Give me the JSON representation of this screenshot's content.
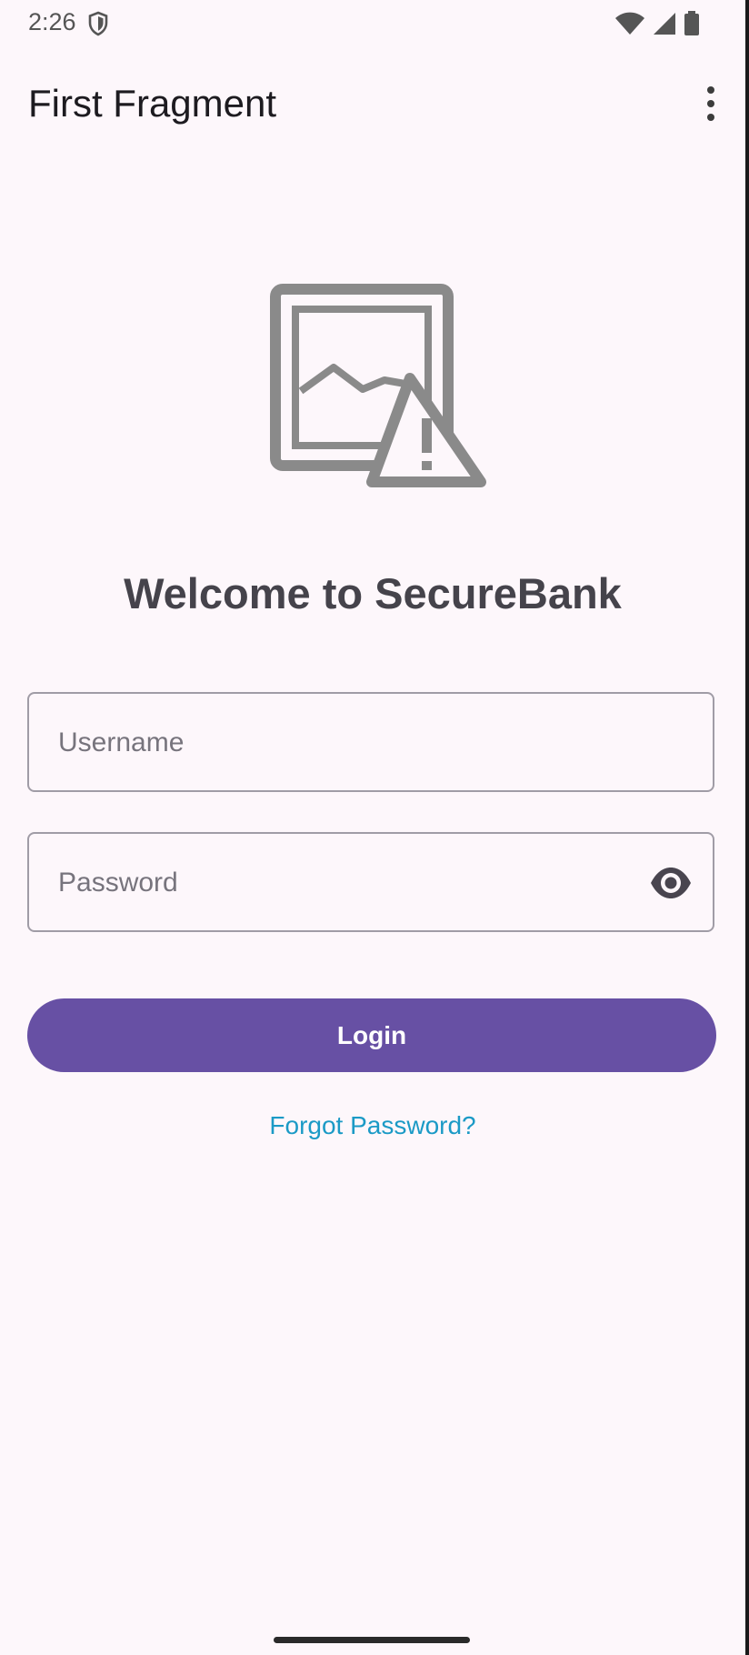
{
  "status_bar": {
    "time": "2:26",
    "icons": [
      "shield-icon",
      "wifi-icon",
      "signal-icon",
      "battery-icon"
    ]
  },
  "app_bar": {
    "title": "First Fragment",
    "overflow_icon": "more-vert-icon"
  },
  "hero": {
    "icon": "broken-image-icon"
  },
  "main": {
    "welcome": "Welcome to SecureBank",
    "username_placeholder": "Username",
    "username_value": "",
    "password_placeholder": "Password",
    "password_value": "",
    "password_toggle_icon": "eye-icon",
    "login_label": "Login",
    "forgot_label": "Forgot Password?"
  },
  "colors": {
    "background": "#fdf7fb",
    "primary": "#6750a4",
    "link": "#1b9ac6",
    "heading": "#45434b"
  }
}
